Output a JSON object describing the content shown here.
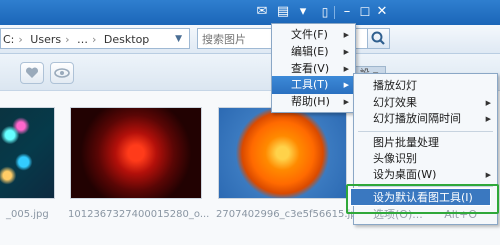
{
  "address": {
    "segments": [
      "C:",
      "Users",
      "…",
      "Desktop"
    ],
    "dropdown_icon": "chevron-down-icon"
  },
  "search": {
    "placeholder": "搜索图片"
  },
  "toolbar": {
    "sort_tab_label": "設"
  },
  "thumbnails": [
    {
      "caption": "_005.jpg"
    },
    {
      "caption": "1012367327400015280_o..."
    },
    {
      "caption": "2707402996_c3e5f56615.jpg"
    }
  ],
  "main_menu": [
    {
      "label": "文件(F)"
    },
    {
      "label": "编辑(E)"
    },
    {
      "label": "查看(V)"
    },
    {
      "label": "工具(T)"
    },
    {
      "label": "帮助(H)"
    }
  ],
  "tools_menu": [
    {
      "label": "播放幻灯"
    },
    {
      "label": "幻灯效果"
    },
    {
      "label": "幻灯播放间隔时间"
    },
    {
      "label": "图片批量处理"
    },
    {
      "label": "头像识别"
    },
    {
      "label": "设为桌面(W)"
    },
    {
      "label": "设为默认看图工具(I)"
    },
    {
      "label": "选项(O)..."
    }
  ],
  "options_shortcut": "Alt+O"
}
